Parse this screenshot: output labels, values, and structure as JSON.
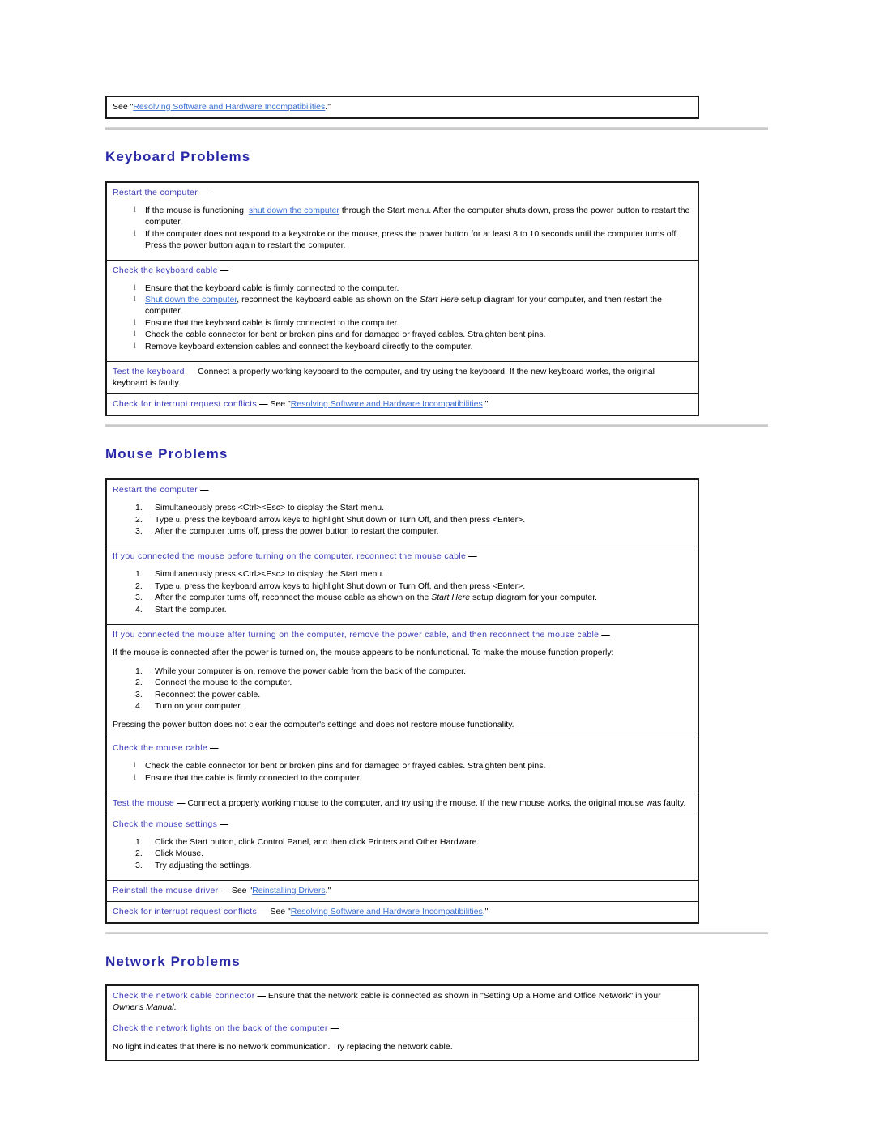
{
  "document": {
    "top_note": {
      "prefix": "See \"",
      "link": "Resolving Software and Hardware Incompatibilities",
      "suffix": ".\""
    },
    "colors": {
      "heading": "#2a2aa8",
      "subheading": "#3a3aba",
      "link": "#3b6fd4",
      "border": "#1a1a1a",
      "rule": "#c9c9c9"
    }
  },
  "sections": [
    {
      "title": "Keyboard Problems",
      "rows": [
        {
          "head": "Restart the computer",
          "dash": "—",
          "list_type": "bullet",
          "items": [
            {
              "parts": [
                {
                  "t": "text",
                  "v": "If the mouse is functioning, "
                },
                {
                  "t": "link",
                  "v": "shut down the computer"
                },
                {
                  "t": "text",
                  "v": " through the Start menu. After the computer shuts down, press the power button to restart the computer."
                }
              ]
            },
            {
              "parts": [
                {
                  "t": "text",
                  "v": "If the computer does not respond to a keystroke or the mouse, press the power button for at least 8 to 10 seconds until the computer turns off. Press the power button again to restart the computer."
                }
              ]
            }
          ]
        },
        {
          "head": "Check the keyboard cable",
          "dash": "—",
          "list_type": "bullet",
          "items": [
            {
              "parts": [
                {
                  "t": "text",
                  "v": "Ensure that the keyboard cable is firmly connected to the computer."
                }
              ]
            },
            {
              "parts": [
                {
                  "t": "link",
                  "v": "Shut down the computer"
                },
                {
                  "t": "text",
                  "v": ", reconnect the keyboard cable as shown on the "
                },
                {
                  "t": "italic",
                  "v": "Start Here"
                },
                {
                  "t": "text",
                  "v": " setup diagram for your computer, and then restart the computer."
                }
              ]
            },
            {
              "parts": [
                {
                  "t": "text",
                  "v": "Ensure that the keyboard cable is firmly connected to the computer."
                }
              ]
            },
            {
              "parts": [
                {
                  "t": "text",
                  "v": "Check the cable connector for bent or broken pins and for damaged or frayed cables. Straighten bent pins."
                }
              ]
            },
            {
              "parts": [
                {
                  "t": "text",
                  "v": "Remove keyboard extension cables and connect the keyboard directly to the computer."
                }
              ]
            }
          ]
        },
        {
          "head": "Test the keyboard",
          "dash": "—",
          "inline": true,
          "body_parts": [
            {
              "t": "text",
              "v": " Connect a properly working keyboard to the computer, and try using the keyboard. If the new keyboard works, the original keyboard is faulty."
            }
          ]
        },
        {
          "head": "Check for interrupt request conflicts",
          "dash": "—",
          "inline": true,
          "body_parts": [
            {
              "t": "text",
              "v": " See \""
            },
            {
              "t": "link",
              "v": "Resolving Software and Hardware Incompatibilities"
            },
            {
              "t": "text",
              "v": ".\""
            }
          ]
        }
      ]
    },
    {
      "title": "Mouse Problems",
      "rows": [
        {
          "head": "Restart the computer",
          "dash": "—",
          "list_type": "number",
          "items": [
            {
              "parts": [
                {
                  "t": "text",
                  "v": "Simultaneously press <Ctrl><Esc> to display the Start menu."
                }
              ]
            },
            {
              "parts": [
                {
                  "t": "text",
                  "v": "Type "
                },
                {
                  "t": "small",
                  "v": "u"
                },
                {
                  "t": "text",
                  "v": ", press the keyboard arrow keys to highlight Shut down or Turn Off, and then press <Enter>."
                }
              ]
            },
            {
              "parts": [
                {
                  "t": "text",
                  "v": "After the computer turns off, press the power button to restart the computer."
                }
              ]
            }
          ]
        },
        {
          "head": "If you connected the mouse before turning on the computer, reconnect the mouse cable",
          "dash": "—",
          "list_type": "number",
          "items": [
            {
              "parts": [
                {
                  "t": "text",
                  "v": "Simultaneously press <Ctrl><Esc> to display the Start menu."
                }
              ]
            },
            {
              "parts": [
                {
                  "t": "text",
                  "v": "Type "
                },
                {
                  "t": "small",
                  "v": "u"
                },
                {
                  "t": "text",
                  "v": ", press the keyboard arrow keys to highlight Shut down or Turn Off, and then press <Enter>."
                }
              ]
            },
            {
              "parts": [
                {
                  "t": "text",
                  "v": "After the computer turns off, reconnect the mouse cable as shown on the "
                },
                {
                  "t": "italic",
                  "v": "Start Here"
                },
                {
                  "t": "text",
                  "v": " setup diagram for your computer."
                }
              ]
            },
            {
              "parts": [
                {
                  "t": "text",
                  "v": "Start the computer."
                }
              ]
            }
          ]
        },
        {
          "head": "If you connected the mouse after turning on the computer, remove the power cable, and then reconnect the mouse cable",
          "dash": "—",
          "list_type": "number",
          "lead_para": "If the mouse is connected after the power is turned on, the mouse appears to be nonfunctional. To make the mouse function properly:",
          "items": [
            {
              "parts": [
                {
                  "t": "text",
                  "v": "While your computer is on, remove the power cable from the back of the computer."
                }
              ]
            },
            {
              "parts": [
                {
                  "t": "text",
                  "v": "Connect the mouse to the computer."
                }
              ]
            },
            {
              "parts": [
                {
                  "t": "text",
                  "v": "Reconnect the power cable."
                }
              ]
            },
            {
              "parts": [
                {
                  "t": "text",
                  "v": "Turn on your computer."
                }
              ]
            }
          ],
          "tail_para": "Pressing the power button does not clear the computer's settings and does not restore mouse functionality."
        },
        {
          "head": "Check the mouse cable",
          "dash": "—",
          "list_type": "bullet",
          "items": [
            {
              "parts": [
                {
                  "t": "text",
                  "v": "Check the cable connector for bent or broken pins and for damaged or frayed cables. Straighten bent pins."
                }
              ]
            },
            {
              "parts": [
                {
                  "t": "text",
                  "v": "Ensure that the cable is firmly connected to the computer."
                }
              ]
            }
          ]
        },
        {
          "head": "Test the mouse",
          "dash": "—",
          "inline": true,
          "body_parts": [
            {
              "t": "text",
              "v": " Connect a properly working mouse to the computer, and try using the mouse. If the new mouse works, the original mouse was faulty."
            }
          ]
        },
        {
          "head": "Check the mouse settings",
          "dash": "—",
          "list_type": "number",
          "items": [
            {
              "parts": [
                {
                  "t": "text",
                  "v": "Click the Start button, click Control Panel, and then click Printers and Other Hardware."
                }
              ]
            },
            {
              "parts": [
                {
                  "t": "text",
                  "v": "Click Mouse."
                }
              ]
            },
            {
              "parts": [
                {
                  "t": "text",
                  "v": "Try adjusting the settings."
                }
              ]
            }
          ]
        },
        {
          "head": "Reinstall the mouse driver",
          "dash": "—",
          "inline": true,
          "body_parts": [
            {
              "t": "text",
              "v": " See \""
            },
            {
              "t": "link",
              "v": "Reinstalling Drivers"
            },
            {
              "t": "text",
              "v": ".\""
            }
          ]
        },
        {
          "head": "Check for interrupt request conflicts",
          "dash": "—",
          "inline": true,
          "body_parts": [
            {
              "t": "text",
              "v": " See \""
            },
            {
              "t": "link",
              "v": "Resolving Software and Hardware Incompatibilities"
            },
            {
              "t": "text",
              "v": ".\""
            }
          ]
        }
      ]
    },
    {
      "title": "Network Problems",
      "rows": [
        {
          "head": "Check the network cable connector",
          "dash": "—",
          "inline": true,
          "body_parts": [
            {
              "t": "text",
              "v": " Ensure that the network cable is connected as shown in \"Setting Up a Home and Office Network\" in your "
            },
            {
              "t": "italic",
              "v": "Owner's Manual"
            },
            {
              "t": "text",
              "v": "."
            }
          ]
        },
        {
          "head": "Check the network lights on the back of the computer",
          "dash": "—",
          "tail_para": "No light indicates that there is no network communication. Try replacing the network cable."
        }
      ]
    }
  ]
}
